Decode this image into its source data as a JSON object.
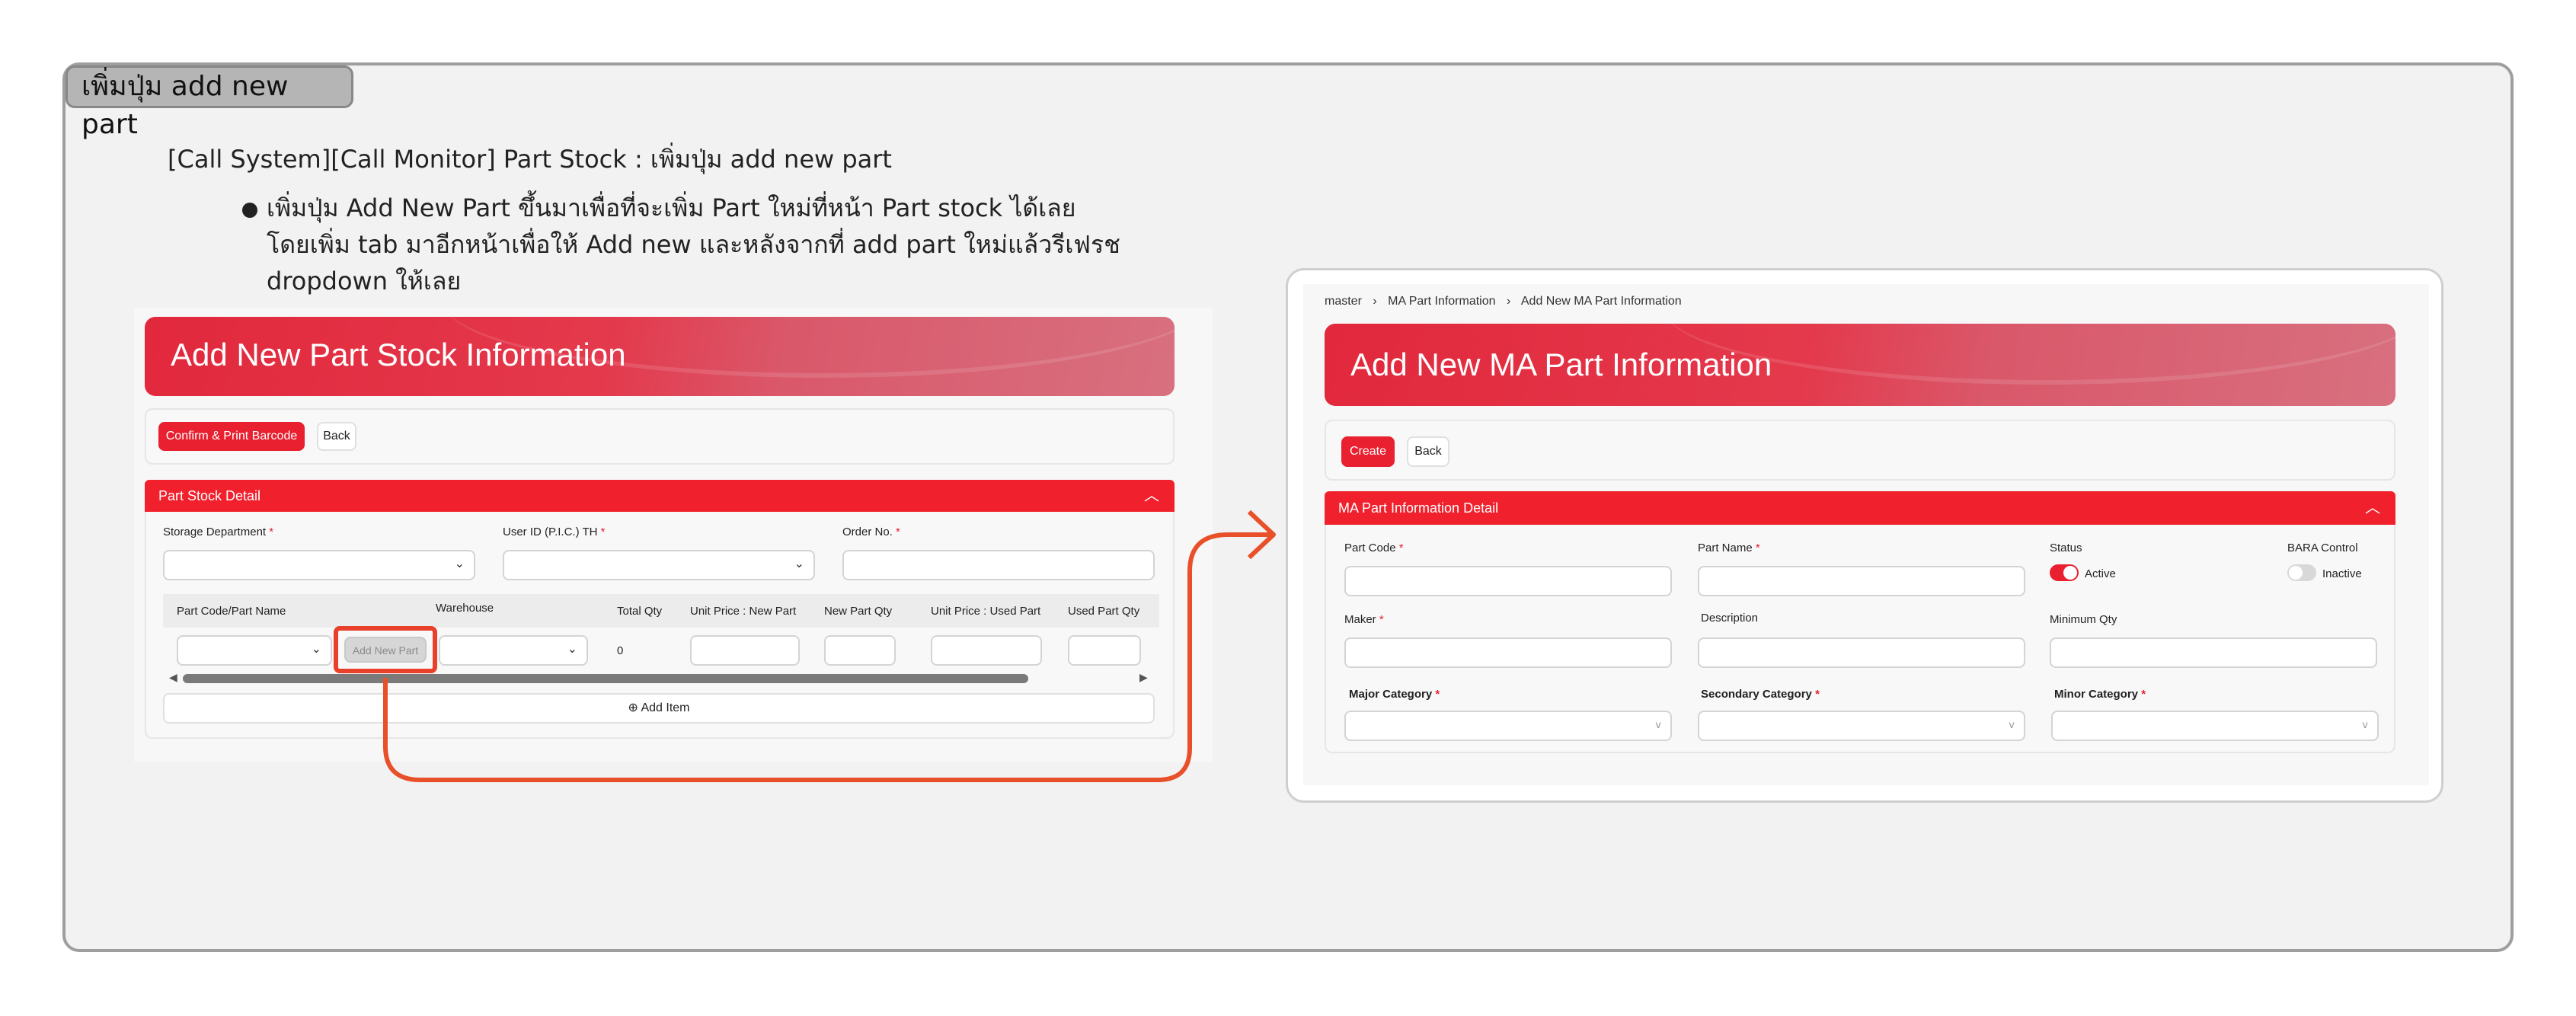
{
  "tag": "เพิ่มปุ่ม add new part",
  "description": {
    "heading": "[Call System][Call Monitor] Part Stock : เพิ่มปุ่ม add new part",
    "bullet_line1": "เพิ่มปุ่ม Add New Part ขึ้นมาเพื่อที่จะเพิ่ม Part ใหม่ที่หน้า Part stock ได้เลย",
    "bullet_line2": "โดยเพิ่ม tab มาอีกหน้าเพื่อให้ Add new และหลังจากที่ add part ใหม่แล้วรีเฟรช",
    "bullet_line3": "dropdown ให้เลย"
  },
  "left_panel": {
    "title": "Add New Part Stock Information",
    "buttons": {
      "confirm": "Confirm & Print Barcode",
      "back": "Back"
    },
    "section_title": "Part Stock Detail",
    "fields": {
      "storage": "Storage Department",
      "user": "User ID (P.I.C.) TH",
      "order": "Order No."
    },
    "required_mark": "*",
    "columns": [
      "Part Code/Part Name",
      "Warehouse",
      "Total Qty",
      "Unit Price : New Part",
      "New Part Qty",
      "Unit Price : Used Part",
      "Used Part Qty"
    ],
    "add_new_part": "Add New Part",
    "total_qty_value": "0",
    "add_item": "Add Item"
  },
  "right_panel": {
    "breadcrumb": [
      "master",
      "MA Part Information",
      "Add New MA Part Information"
    ],
    "title": "Add New MA Part Information",
    "buttons": {
      "create": "Create",
      "back": "Back"
    },
    "section_title": "MA Part Information Detail",
    "fields": {
      "part_code": "Part Code",
      "part_name": "Part Name",
      "status": "Status",
      "status_value": "Active",
      "bara": "BARA Control",
      "bara_value": "Inactive",
      "maker": "Maker",
      "description": "Description",
      "min_qty": "Minimum Qty",
      "major": "Major Category",
      "secondary": "Secondary Category",
      "minor": "Minor Category"
    }
  },
  "colors": {
    "brand_red": "#e8202f",
    "arrow": "#e8502a",
    "highlight": "#e8402a"
  }
}
